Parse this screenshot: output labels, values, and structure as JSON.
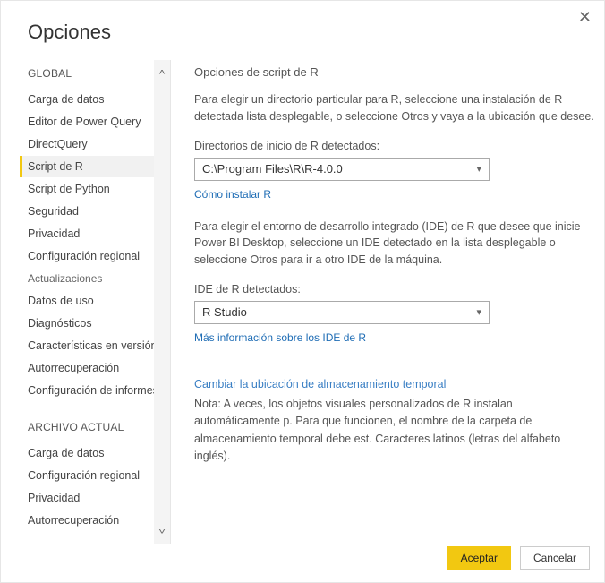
{
  "dialog": {
    "title": "Opciones",
    "close_glyph": "✕"
  },
  "sidebar": {
    "sections": [
      {
        "header": "GLOBAL",
        "items": [
          {
            "label": "Carga de datos"
          },
          {
            "label": "Editor de Power Query"
          },
          {
            "label": "DirectQuery"
          },
          {
            "label": "Script de R",
            "selected": true
          },
          {
            "label": "Script de Python"
          },
          {
            "label": "Seguridad"
          },
          {
            "label": "Privacidad"
          },
          {
            "label": "Configuración regional"
          },
          {
            "label": "Actualizaciones",
            "small": true
          },
          {
            "label": "Datos de uso"
          },
          {
            "label": "Diagnósticos"
          },
          {
            "label": "Características en versión preliminar"
          },
          {
            "label": "Autorrecuperación"
          },
          {
            "label": "Configuración de informes"
          }
        ]
      },
      {
        "header": "ARCHIVO ACTUAL",
        "items": [
          {
            "label": "Carga de datos"
          },
          {
            "label": "Configuración regional"
          },
          {
            "label": "Privacidad"
          },
          {
            "label": "Autorrecuperación"
          }
        ]
      }
    ],
    "scroll_up": "˄",
    "scroll_down": "˅"
  },
  "panel": {
    "title": "Opciones de script de R",
    "intro": "Para elegir un directorio particular para R, seleccione una instalación de R detectada lista desplegable, o seleccione Otros y vaya a la ubicación que desee.",
    "dir_label": "Directorios de inicio de R detectados:",
    "dir_value": "C:\\Program Files\\R\\R-4.0.0",
    "install_link": "Cómo instalar R",
    "ide_intro": "Para elegir el entorno de desarrollo integrado (IDE) de R que desee que inicie Power BI Desktop, seleccione un IDE detectado en la lista desplegable o seleccione Otros para ir a otro IDE de la máquina.",
    "ide_label": "IDE de R detectados:",
    "ide_value": "R Studio",
    "ide_link": "Más información sobre los IDE de R",
    "temp_link": "Cambiar la ubicación de almacenamiento temporal",
    "note": "Nota: A veces, los objetos visuales personalizados de R instalan automáticamente p. Para que funcionen, el nombre de la carpeta de almacenamiento temporal debe est. Caracteres latinos (letras del alfabeto inglés)."
  },
  "footer": {
    "ok": "Aceptar",
    "cancel": "Cancelar"
  }
}
